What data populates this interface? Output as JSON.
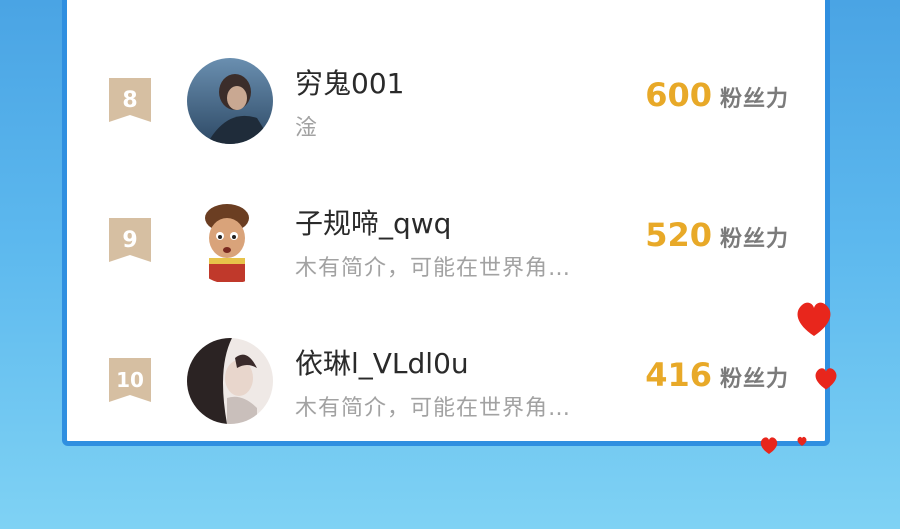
{
  "ranking": [
    {
      "rank": "8",
      "name": "穷鬼001",
      "bio": "淦",
      "score": "600",
      "unit": "粉丝力"
    },
    {
      "rank": "9",
      "name": "子规啼_qwq",
      "bio": "木有简介，可能在世界角…",
      "score": "520",
      "unit": "粉丝力"
    },
    {
      "rank": "10",
      "name": "依琳l_VLdl0u",
      "bio": "木有简介，可能在世界角…",
      "score": "416",
      "unit": "粉丝力"
    }
  ],
  "colors": {
    "accent": "#e8a928",
    "border": "#2f8fe0",
    "rank_badge": "#d6bfa2"
  }
}
